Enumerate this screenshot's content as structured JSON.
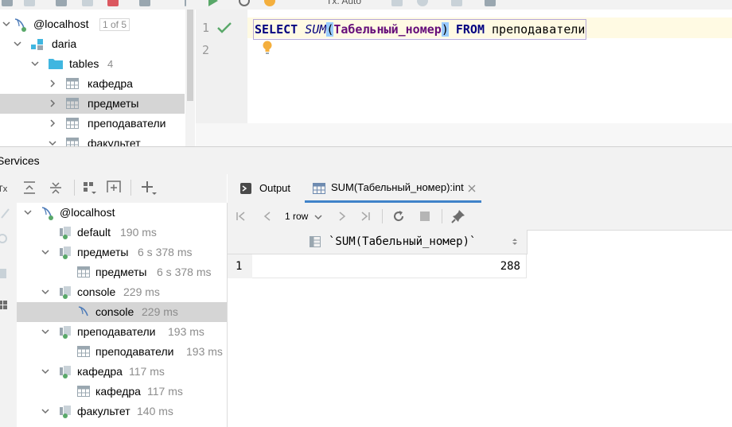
{
  "db_tree": {
    "host": "@localhost",
    "host_badge": "1 of 5",
    "database": "daria",
    "tables_folder": "tables",
    "tables_count": "4",
    "tables": [
      {
        "label": "кафедра"
      },
      {
        "label": "предметы"
      },
      {
        "label": "преподаватели"
      },
      {
        "label": "факультет"
      }
    ]
  },
  "editor": {
    "line_numbers": [
      "1",
      "2"
    ],
    "sql": {
      "select": "SELECT",
      "func": "SUM",
      "open_paren": "(",
      "arg": "Табельный_номер",
      "close_paren": ")",
      "from": "FROM",
      "table": "преподаватели"
    },
    "tx_label": "Tx: Auto"
  },
  "services": {
    "title": "Services",
    "tree": [
      {
        "label": "@localhost",
        "time": ""
      },
      {
        "label": "default",
        "time": "190 ms"
      },
      {
        "label": "предметы",
        "time": "6 s 378 ms"
      },
      {
        "label": "предметы",
        "time": "6 s 378 ms"
      },
      {
        "label": "console",
        "time": "229 ms"
      },
      {
        "label": "console",
        "time": "229 ms"
      },
      {
        "label": "преподаватели",
        "time": "193 ms"
      },
      {
        "label": "преподаватели",
        "time": "193 ms"
      },
      {
        "label": "кафедра",
        "time": "117 ms"
      },
      {
        "label": "кафедра",
        "time": "117 ms"
      },
      {
        "label": "факультет",
        "time": "140 ms"
      }
    ]
  },
  "results": {
    "tabs": [
      {
        "label": "Output"
      },
      {
        "label": "SUM(Табельный_номер):int"
      }
    ],
    "rows_label": "1 row",
    "column_header": "`SUM(Табельный_номер)`",
    "row_number": "1",
    "value": "288"
  },
  "colors": {
    "keyword": "#000080",
    "selection": "#d5d5d5",
    "accent_tab": "#4083c9",
    "run_green": "#59a869"
  }
}
